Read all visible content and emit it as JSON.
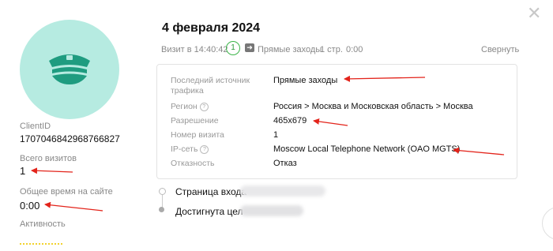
{
  "visitor": {
    "client_id_label": "ClientID",
    "client_id": "1707046842968766827",
    "total_visits_label": "Всего визитов",
    "total_visits": "1",
    "total_time_label": "Общее время на сайте",
    "total_time": "0:00",
    "activity_label": "Активность"
  },
  "visit": {
    "date": "4 февраля 2024",
    "time_label": "Визит в 14:40:42",
    "visit_number_badge": "1",
    "source": "Прямые заходы",
    "pages": "1 стр.",
    "duration": "0:00",
    "collapse_label": "Свернуть"
  },
  "details": {
    "rows": [
      {
        "key": "Последний источник трафика",
        "value": "Прямые заходы",
        "help": false
      },
      {
        "key": "Регион",
        "value": "Россия > Москва и Московская область > Москва",
        "help": true
      },
      {
        "key": "Разрешение",
        "value": "465x679",
        "help": false
      },
      {
        "key": "Номер визита",
        "value": "1",
        "help": false
      },
      {
        "key": "IP-сеть",
        "value": "Moscow Local Telephone Network (OAO MGTS)",
        "help": true
      },
      {
        "key": "Отказность",
        "value": "Отказ",
        "help": false
      }
    ]
  },
  "timeline": {
    "entry_page_label": "Страница входа",
    "goal_label": "Достигнута цел"
  },
  "icons": {
    "avatar": "police-cap-icon",
    "close": "close-icon",
    "source": "direct-entry-icon",
    "help": "help-icon"
  },
  "colors": {
    "avatar_bg": "#b6ebe1",
    "avatar_icon": "#1f9c80",
    "badge_green": "#3cb54a",
    "annotation_red": "#e3241b"
  }
}
